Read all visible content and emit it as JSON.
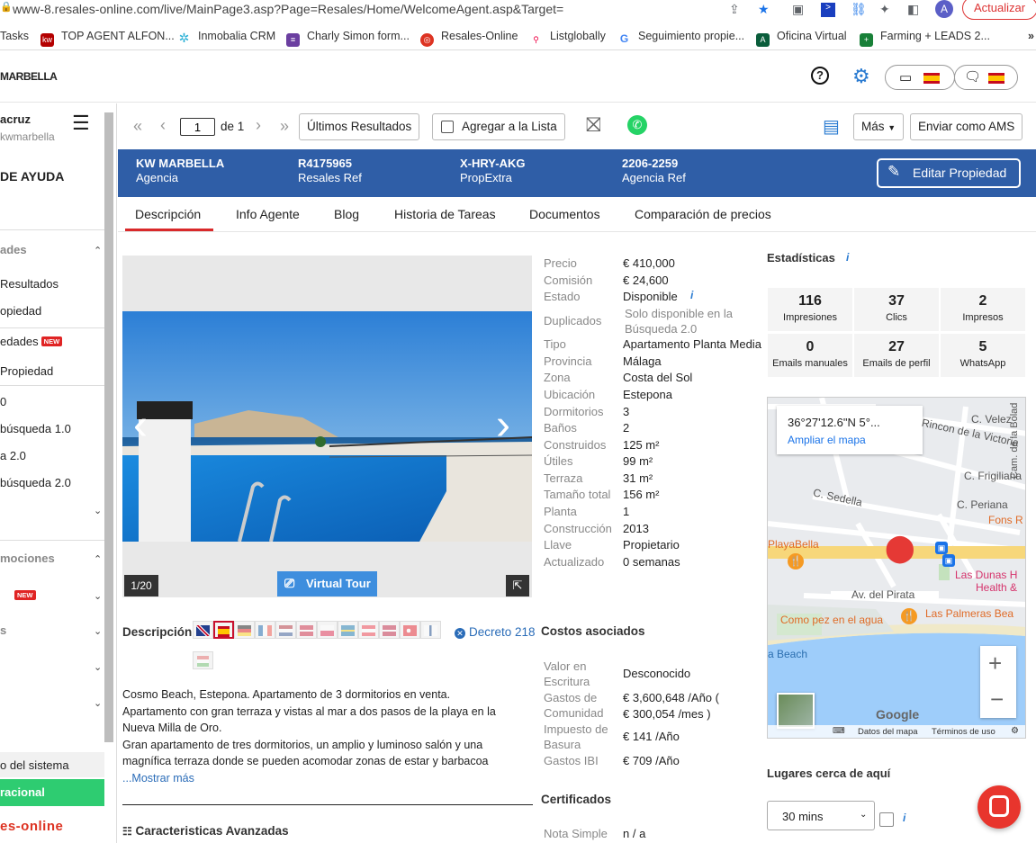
{
  "browser": {
    "url": "www-8.resales-online.com/live/MainPage3.asp?Page=Resales/Home/WelcomeAgent.asp&Target=",
    "update_label": "Actualizar",
    "profile_initial": "A",
    "bookmarks": [
      "Tasks",
      "TOP AGENT ALFON...",
      "Inmobalia CRM",
      "Charly Simon form...",
      "Resales-Online",
      "Listglobally",
      "Seguimiento propie...",
      "Oficina Virtual",
      "Farming + LEADS 2..."
    ]
  },
  "header": {
    "logo": "MARBELLA",
    "help": "?"
  },
  "sidebar": {
    "user": "acruz",
    "office": "kwmarbella",
    "help_title": "DE AYUDA",
    "section1": "ades",
    "items1": [
      "Resultados",
      "opiedad",
      "edades",
      "Propiedad",
      "0",
      "búsqueda 1.0",
      "a 2.0",
      "búsqueda 2.0"
    ],
    "new_badge": "NEW",
    "section2": "mociones",
    "section3": "s",
    "system": "o del sistema",
    "operational": "racional",
    "brand": "es-online"
  },
  "toolbar": {
    "page_value": "1",
    "of_label": "de 1",
    "results_label": "Últimos Resultados",
    "add_list_label": "Agregar a la Lista",
    "more_label": "Más",
    "send_ams_label": "Enviar como AMS"
  },
  "band": {
    "agency_name": "KW MARBELLA",
    "agency_label": "Agencia",
    "ref": "R4175965",
    "ref_label": "Resales Ref",
    "propextra": "X-HRY-AKG",
    "propextra_label": "PropExtra",
    "agency_ref": "2206-2259",
    "agency_ref_label": "Agencia Ref",
    "edit_label": "Editar Propiedad"
  },
  "tabs": [
    "Descripción",
    "Info Agente",
    "Blog",
    "Historia de Tareas",
    "Documentos",
    "Comparación de precios"
  ],
  "photo": {
    "counter": "1/20",
    "virtual_tour": "Virtual Tour"
  },
  "details": [
    {
      "label": "Precio",
      "value": "€ 410,000"
    },
    {
      "label": "Comisión",
      "value": "€ 24,600"
    },
    {
      "label": "Estado",
      "value": "Disponible"
    },
    {
      "label": "Duplicados",
      "value": "Solo disponible en la"
    },
    {
      "label": "",
      "value": "Búsqueda 2.0"
    },
    {
      "label": "Tipo",
      "value": "Apartamento Planta Media"
    },
    {
      "label": "Provincia",
      "value": "Málaga"
    },
    {
      "label": "Zona",
      "value": "Costa del Sol"
    },
    {
      "label": "Ubicación",
      "value": "Estepona"
    },
    {
      "label": "Dormitorios",
      "value": "3"
    },
    {
      "label": "Baños",
      "value": "2"
    },
    {
      "label": "Construidos",
      "value": "125 m²"
    },
    {
      "label": "Útiles",
      "value": "99 m²"
    },
    {
      "label": "Terraza",
      "value": "31 m²"
    },
    {
      "label": "Tamaño total",
      "value": "156 m²"
    },
    {
      "label": "Planta",
      "value": "1"
    },
    {
      "label": "Construcción",
      "value": "2013"
    },
    {
      "label": "Llave",
      "value": "Propietario"
    },
    {
      "label": "Actualizado",
      "value": "0 semanas"
    }
  ],
  "stats": {
    "title": "Estadísticas",
    "cells": [
      {
        "value": "116",
        "label": "Impresiones"
      },
      {
        "value": "37",
        "label": "Clics"
      },
      {
        "value": "2",
        "label": "Impresos"
      },
      {
        "value": "0",
        "label": "Emails manuales"
      },
      {
        "value": "27",
        "label": "Emails de perfil"
      },
      {
        "value": "5",
        "label": "WhatsApp"
      }
    ]
  },
  "map": {
    "coords": "36°27'12.6\"N 5°...",
    "enlarge": "Ampliar el mapa",
    "labels": [
      "C. Velez",
      "Rincon de la Victoria",
      "C. Frigiliana",
      "C. Sedella",
      "C. Periana",
      "Cam. de la Bolad",
      "Fons R",
      "PlayaBella",
      "Las Dunas H",
      "Health &",
      "Av. del Pirata",
      "Como pez en el agua",
      "Las Palmeras Bea",
      "a Beach"
    ],
    "google": "Google",
    "footer": [
      "Datos del mapa",
      "Términos de uso"
    ]
  },
  "description": {
    "title": "Descripción",
    "decree": "Decreto 218",
    "text1": "Cosmo Beach, Estepona. Apartamento de 3 dormitorios en venta.",
    "text2": "Apartamento con gran terraza y vistas al mar a dos pasos de la playa en la",
    "text3": "Nueva Milla de Oro.",
    "text4": "Gran apartamento de tres dormitorios, un amplio y luminoso salón y una",
    "text5": "magnífica terraza donde se pueden acomodar zonas de estar y barbacoa",
    "more": "...Mostrar más",
    "advanced": "Caracteristicas Avanzadas"
  },
  "costs": {
    "title": "Costos asociados",
    "rows": [
      {
        "label1": "Valor en",
        "label2": "Escritura",
        "value1": "Desconocido",
        "value2": ""
      },
      {
        "label1": "Gastos de",
        "label2": "Comunidad",
        "value1": "€ 3,600,648 /Año (",
        "value2": "€ 300,054 /mes )"
      },
      {
        "label1": "Impuesto de",
        "label2": "Basura",
        "value1": "€ 141 /Año",
        "value2": ""
      },
      {
        "label1": "Gastos IBI",
        "label2": "",
        "value1": "€ 709 /Año",
        "value2": ""
      }
    ],
    "cert_title": "Certificados",
    "note_label": "Nota Simple",
    "note_value": "n / a"
  },
  "places": {
    "title": "Lugares cerca de aquí",
    "select_value": "30 mins"
  },
  "colors": {
    "band": "#2f5ea7",
    "accent": "#d9292a",
    "green": "#2ecc71"
  }
}
